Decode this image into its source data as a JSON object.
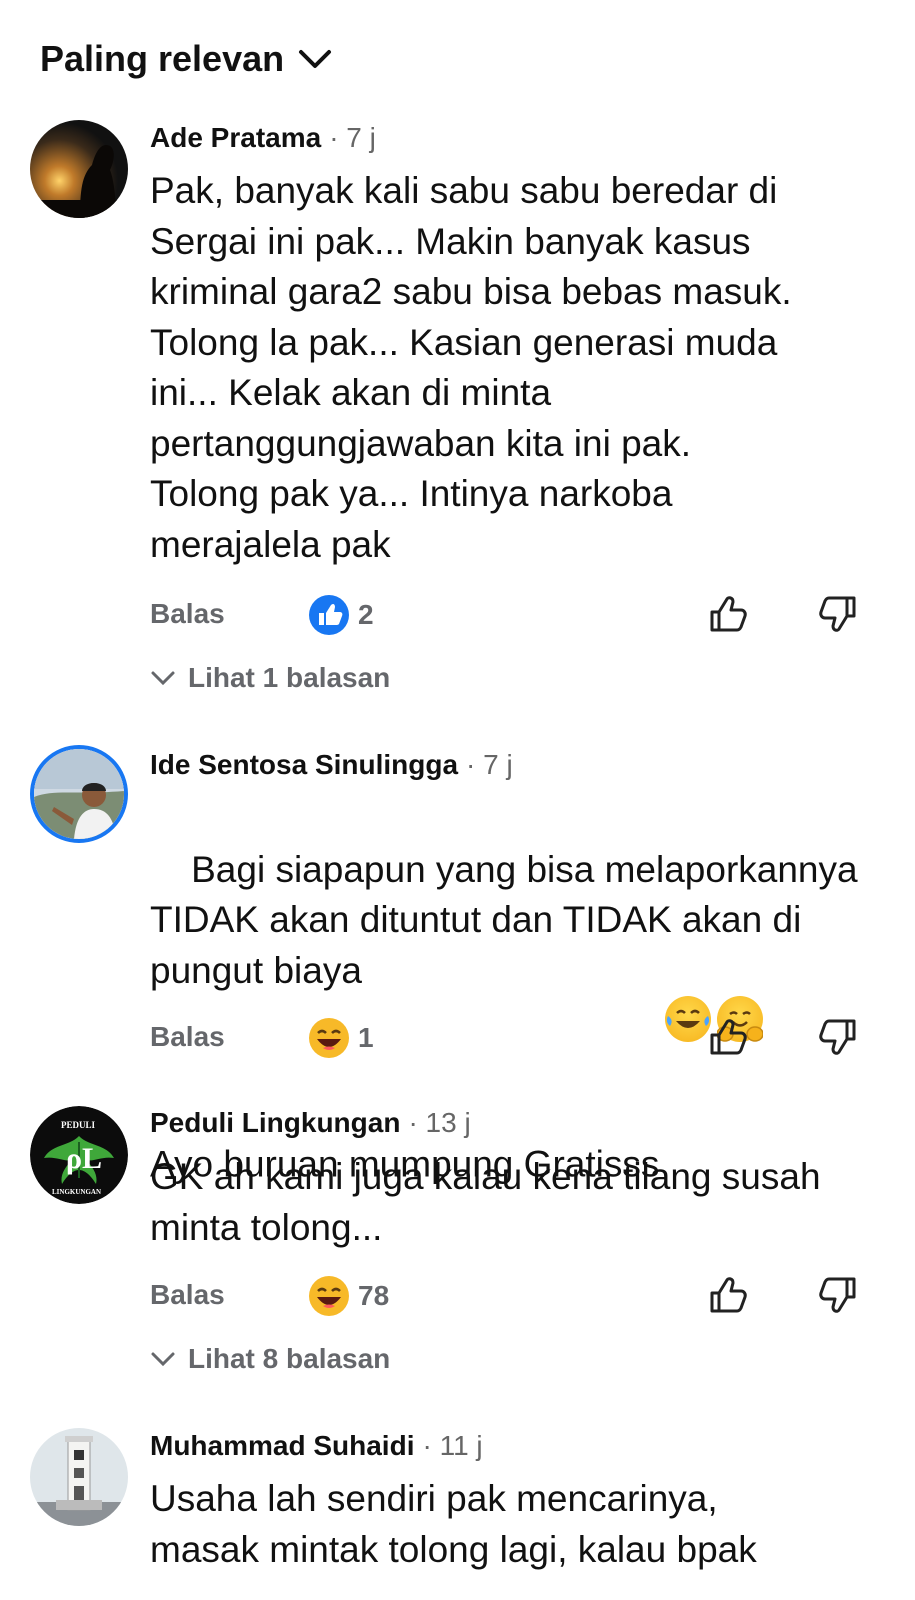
{
  "sort": {
    "label": "Paling relevan"
  },
  "comments": [
    {
      "author": "Ade Pratama",
      "time": "· 7 j",
      "text": "Pak, banyak kali sabu sabu beredar di\nSergai ini pak... Makin banyak kasus\nkriminal gara2 sabu bisa bebas masuk.\nTolong la pak... Kasian generasi muda\nini... Kelak akan di minta\npertanggungjawaban kita ini pak.\nTolong pak ya... Intinya narkoba\nmerajalela pak",
      "reply_label": "Balas",
      "reaction_icon": "like-reaction-icon",
      "reaction_count": "2",
      "view_replies": "Lihat 1 balasan"
    },
    {
      "author": "Ide Sentosa Sinulingga",
      "time": "· 7 j",
      "text": "Bagi siapapun yang bisa melaporkannya\nTIDAK akan dituntut dan TIDAK akan di\npungut biaya\nAyo buruan mumpung Gratisss",
      "text_emojis": [
        "tears-of-joy-emoji",
        "hugging-face-emoji"
      ],
      "reply_label": "Balas",
      "reaction_icon": "haha-reaction-icon",
      "reaction_count": "1"
    },
    {
      "author": "Peduli Lingkungan",
      "time": "· 13 j",
      "text": "GK ah kami juga kalau kena tilang susah\nminta tolong...",
      "reply_label": "Balas",
      "reaction_icon": "haha-reaction-icon",
      "reaction_count": "78",
      "view_replies": "Lihat 8 balasan",
      "avatar_text_top": "PEDULI",
      "avatar_text_bottom": "LINGKUNGAN"
    },
    {
      "author": "Muhammad Suhaidi",
      "time": "· 11 j",
      "text": "Usaha lah sendiri pak mencarinya,\nmasak mintak tolong lagi, kalau bpak"
    }
  ],
  "colors": {
    "text": "#111111",
    "meta": "#65676b",
    "like_blue": "#1877f2",
    "haha_yellow": "#f7b928",
    "avatar_ring": "#1877f2"
  }
}
